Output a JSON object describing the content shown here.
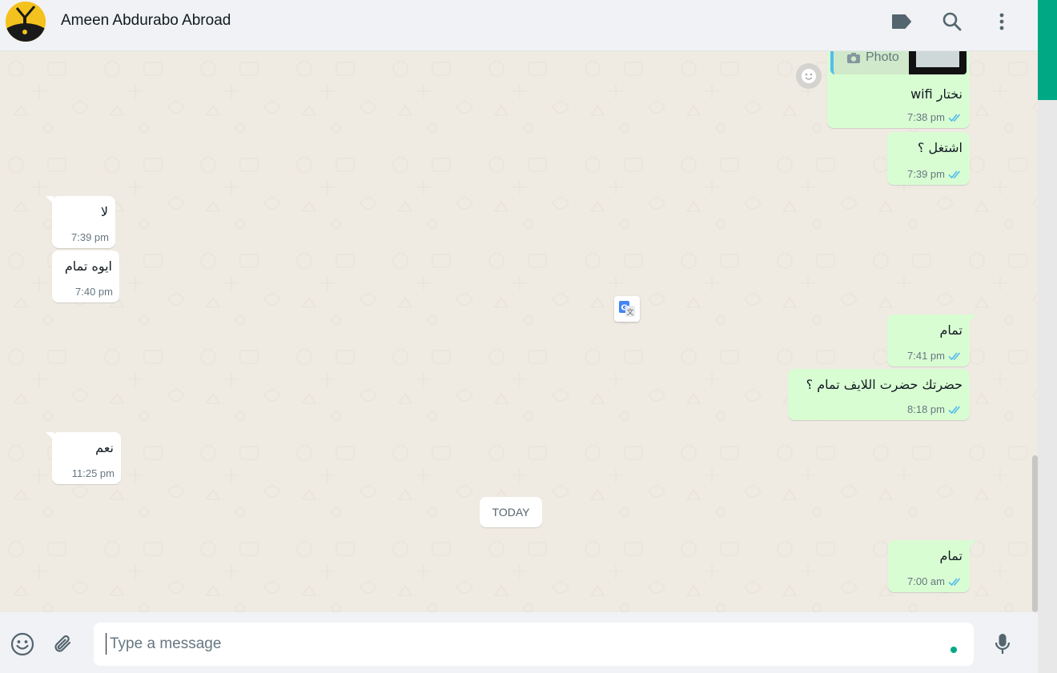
{
  "header": {
    "contact_name": "Ameen Abdurabo Abroad",
    "icons": [
      "label-icon",
      "search-icon",
      "more-vertical-icon"
    ]
  },
  "colors": {
    "accent": "#00a884",
    "outgoing_bubble": "#d9fdd3",
    "incoming_bubble": "#ffffff",
    "read_ticks": "#53bdeb",
    "chat_background": "#efeae2"
  },
  "messages": [
    {
      "direction": "out",
      "reply_label": "Photo",
      "text": "نختار wifi",
      "time": "7:38 pm",
      "status": "read"
    },
    {
      "direction": "out",
      "text": "اشتغل ؟",
      "time": "7:39 pm",
      "status": "read"
    },
    {
      "direction": "in",
      "text": "لا",
      "time": "7:39 pm"
    },
    {
      "direction": "in",
      "text": "ايوه تمام",
      "time": "7:40 pm"
    },
    {
      "direction": "out",
      "text": "تمام",
      "time": "7:41 pm",
      "status": "read"
    },
    {
      "direction": "out",
      "text": "حضرتك حضرت اللايف تمام ؟",
      "time": "8:18 pm",
      "status": "read"
    },
    {
      "direction": "in",
      "text": "نعم",
      "time": "11:25 pm"
    },
    {
      "direction": "out",
      "text": "تمام",
      "time": "7:00 am",
      "status": "read"
    }
  ],
  "date_divider": "TODAY",
  "composer": {
    "placeholder": "Type a message",
    "value": ""
  }
}
